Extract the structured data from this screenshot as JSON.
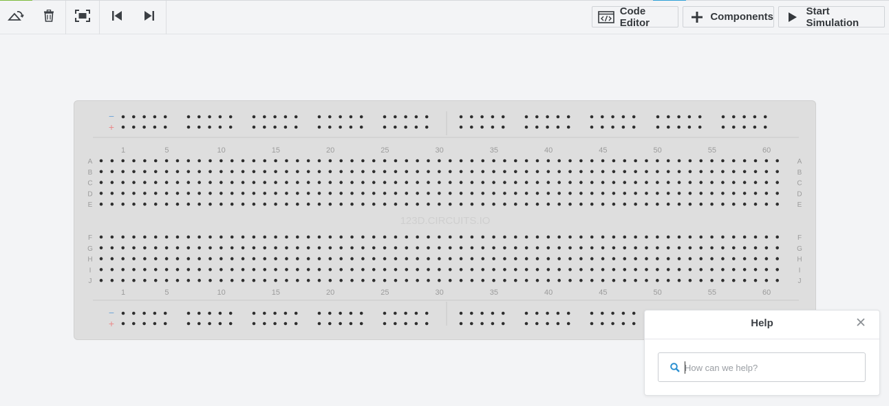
{
  "toolbar": {
    "left_tools": [
      {
        "name": "rotate-icon"
      },
      {
        "name": "trash-icon"
      },
      {
        "name": "fit-view-icon"
      },
      {
        "name": "skip-back-icon"
      },
      {
        "name": "skip-forward-icon"
      }
    ],
    "code_editor_label": "Code Editor",
    "components_label": "Components",
    "start_simulation_label": "Start Simulation"
  },
  "breadboard": {
    "watermark": "123D.CIRCUITS.IO",
    "column_numbers": [
      "1",
      "5",
      "10",
      "15",
      "20",
      "25",
      "30",
      "35",
      "40",
      "45",
      "50",
      "55",
      "60"
    ],
    "top_rows": [
      "A",
      "B",
      "C",
      "D",
      "E"
    ],
    "bottom_rows": [
      "F",
      "G",
      "H",
      "I",
      "J"
    ],
    "rail_minus": "−",
    "rail_plus": "+",
    "columns": 63,
    "colors": {
      "board": "#dedede",
      "hole": "#2e2e2e",
      "label": "#9b9b9b",
      "minus": "#6fa5d8",
      "plus": "#ea8a8a"
    }
  },
  "help": {
    "title": "Help",
    "search_placeholder": "How can we help?"
  }
}
